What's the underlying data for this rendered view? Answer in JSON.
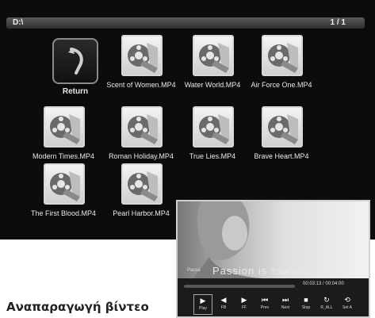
{
  "browser": {
    "path": "D:\\",
    "page": "1 / 1",
    "return_label": "Return",
    "files": [
      "Scent of Women.MP4",
      "Water World.MP4",
      "Air Force One.MP4",
      "Modern Times.MP4",
      "Roman Holiday.MP4",
      "True Lies.MP4",
      "Brave Heart.MP4",
      "The First Blood.MP4",
      "Pearl Harbor.MP4"
    ]
  },
  "player": {
    "subtitle": "Passion is sweet",
    "pause_label": "Pause",
    "time": "00:03:13 / 00:04:00",
    "controls": [
      {
        "icon": "play-icon",
        "glyph": "▶",
        "label": "Play"
      },
      {
        "icon": "fast-backward-icon",
        "glyph": "◀",
        "label": "FB"
      },
      {
        "icon": "fast-forward-icon",
        "glyph": "▶",
        "label": "FF"
      },
      {
        "icon": "previous-icon",
        "glyph": "⏮",
        "label": "Prev"
      },
      {
        "icon": "next-icon",
        "glyph": "⏭",
        "label": "Next"
      },
      {
        "icon": "stop-icon",
        "glyph": "■",
        "label": "Stop"
      },
      {
        "icon": "repeat-icon",
        "glyph": "↻",
        "label": "R_ALL"
      },
      {
        "icon": "set-a-icon",
        "glyph": "⟲",
        "label": "Set A"
      }
    ]
  },
  "caption": "Αναπαραγωγή βίντεο"
}
